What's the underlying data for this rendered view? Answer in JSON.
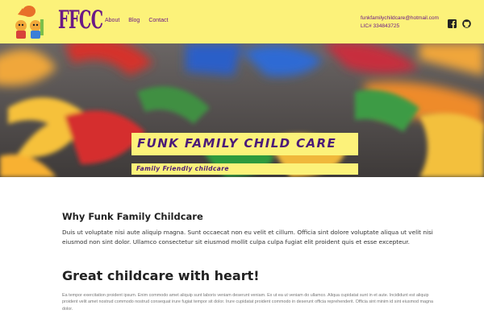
{
  "header": {
    "brand": "FFCC",
    "nav": [
      {
        "label": "About"
      },
      {
        "label": "Blog"
      },
      {
        "label": "Contact"
      }
    ],
    "email": "funkfamilychildcare@hotmail.com",
    "license": "LIC# 334843725",
    "social_icons": [
      "facebook-icon",
      "github-icon"
    ],
    "colors": {
      "background": "#fcf27a",
      "brand": "#6b1a86"
    }
  },
  "hero": {
    "title": "FUNK FAMILY CHILD CARE",
    "subtitle": "Family Friendly childcare",
    "colors": {
      "banner": "#fcf27a",
      "text": "#4b1a78"
    }
  },
  "main": {
    "why_heading": "Why Funk Family Childcare",
    "why_body": "Duis ut voluptate nisi aute aliquip magna. Sunt occaecat non eu velit et cillum. Officia sint dolore voluptate aliqua ut velit nisi eiusmod non sint dolor. Ullamco consectetur sit eiusmod mollit culpa culpa fugiat elit proident quis et esse excepteur.",
    "great_heading": "Great childcare with heart!",
    "great_body": "Ea tempor exercitation proident ipsum. Enim commodo amet aliquip sunt laboris veniam deserunt veniam. Ex ut ea ut veniam do ullamco. Aliqua cupidatat sunt in et aute. Incididunt est aliquip proident velit amet nostrud commodo nostrud consequat irure fugiat tempor sit dolor. Irure cupidatat proident commodo in deserunt officia reprehenderit. Officia sint minim id sint eiusmod magna dolor."
  }
}
